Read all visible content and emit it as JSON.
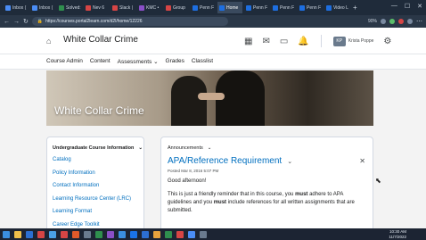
{
  "browser": {
    "tabs": [
      {
        "label": "Inbox (",
        "color": "#4a8df6"
      },
      {
        "label": "Inbox (",
        "color": "#4a8df6"
      },
      {
        "label": "Solved:",
        "color": "#2f8f4e"
      },
      {
        "label": "Nev 6",
        "color": "#d64545"
      },
      {
        "label": "Slack |",
        "color": "#d64545"
      },
      {
        "label": "KMC •",
        "color": "#8a4fc7"
      },
      {
        "label": "Group",
        "color": "#d64545"
      },
      {
        "label": "Penn F",
        "color": "#1d6ee0"
      },
      {
        "label": "Home",
        "color": "#1d6ee0"
      },
      {
        "label": "Penn F",
        "color": "#1d6ee0"
      },
      {
        "label": "Penn F",
        "color": "#1d6ee0"
      },
      {
        "label": "Penn F",
        "color": "#1d6ee0"
      },
      {
        "label": "Video L",
        "color": "#1d6ee0"
      }
    ],
    "active_tab_index": 8,
    "url": "https://courses.portal2learn.com/d2l/home/12226",
    "zoom": "90%"
  },
  "header": {
    "course_title": "White Collar Crime",
    "user_initials": "KP",
    "user_name": "Krista Poppe"
  },
  "nav": {
    "items": [
      "Course Admin",
      "Content",
      "Assessments ⌄",
      "Grades",
      "Classlist"
    ]
  },
  "banner": {
    "title": "White Collar Crime"
  },
  "left_widget": {
    "title": "Undergraduate Course Information",
    "links": [
      "Catalog",
      "Policy Information",
      "Contact Information",
      "Learning Resource Center (LRC)",
      "Learning Format",
      "Career Edge Toolkit"
    ]
  },
  "announcements": {
    "widget_title": "Announcements",
    "title": "APA/Reference Requirement",
    "posted": "Posted Mar 8, 2016 5:07 PM",
    "greeting": "Good afternoon!",
    "body_parts": [
      "This is just a friendly reminder that in this course, you ",
      "must",
      " adhere to APA guidelines and you ",
      "must",
      " include references for all written assignments that are submitted."
    ]
  },
  "taskbar": {
    "time": "10:30 AM",
    "date": "11/7/2022"
  }
}
